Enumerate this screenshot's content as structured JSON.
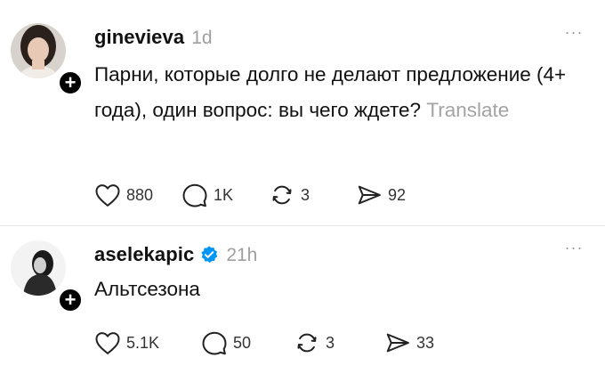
{
  "posts": [
    {
      "username": "ginevieva",
      "time": "1d",
      "verified": false,
      "text": "Парни, которые долго не делают предложение (4+ года), один вопрос: вы чего ждете?",
      "translate_label": "Translate",
      "likes": "880",
      "replies": "1K",
      "reposts": "3",
      "shares": "92"
    },
    {
      "username": "aselekapic",
      "time": "21h",
      "verified": true,
      "text": "Альтсезона",
      "likes": "5.1K",
      "replies": "50",
      "reposts": "3",
      "shares": "33"
    }
  ],
  "more_label": "...",
  "follow_plus": "+",
  "colors": {
    "verified": "#0095f6",
    "muted": "#a0a0a0"
  }
}
